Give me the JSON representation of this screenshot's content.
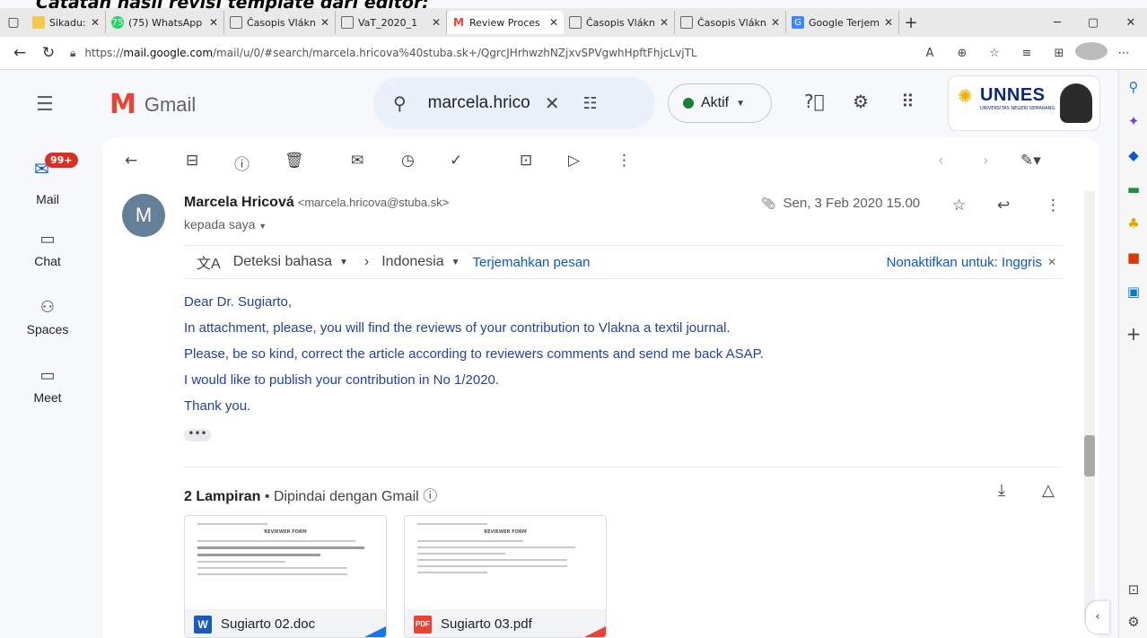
{
  "overlay_caption": "Catatan hasil revisi template dari editor:",
  "browser": {
    "tabs": [
      {
        "title": "Sikadu: UNNES",
        "icon": "folder-icon",
        "color": "#f2c94c",
        "active": false
      },
      {
        "title": "(75) WhatsApp",
        "icon": "whatsapp-icon",
        "color": "#25d366",
        "active": false
      },
      {
        "title": "Časopis Vlákna",
        "icon": "page-icon",
        "color": "#666666",
        "active": false
      },
      {
        "title": "VaT_2020_1",
        "icon": "page-icon",
        "color": "#666666",
        "active": false
      },
      {
        "title": "Review Proces",
        "icon": "gmail-icon",
        "color": "#ea4335",
        "active": true
      },
      {
        "title": "Časopis Vlákna",
        "icon": "page-icon",
        "color": "#666666",
        "active": false
      },
      {
        "title": "Časopis Vlákna",
        "icon": "page-icon",
        "color": "#666666",
        "active": false
      },
      {
        "title": "Google Terjemahan",
        "icon": "translate-icon",
        "color": "#4285f4",
        "active": false
      }
    ],
    "url": {
      "prefix": "https://",
      "host": "mail.google.com",
      "path": "/mail/u/0/#search/marcela.hricova%40stuba.sk+/QgrcJHrhwzhNZjxvSPVgwhHpftFhjcLvjTL"
    }
  },
  "gmail": {
    "app_name": "Gmail",
    "search_value": "marcela.hrico",
    "status_label": "Aktif",
    "brand_text": "UNNES",
    "brand_subtext": "UNIVERSITAS NEGERI SEMARANG",
    "rail": {
      "mail_badge": "99+",
      "items": [
        "Mail",
        "Chat",
        "Spaces",
        "Meet"
      ]
    },
    "message": {
      "sender_initial": "M",
      "sender_name": "Marcela Hricová",
      "sender_email": "<marcela.hricova@stuba.sk>",
      "to_label": "kepada saya",
      "date": "Sen, 3 Feb 2020 15.00",
      "translate": {
        "detect_label": "Deteksi bahasa",
        "target_label": "Indonesia",
        "translate_link": "Terjemahkan pesan",
        "disable_link": "Nonaktifkan untuk: Inggris"
      },
      "body_lines": [
        "Dear Dr. Sugiarto,",
        "In attachment, please, you will find the reviews of your contribution to Vlakna a textil journal.",
        "Please, be so kind, correct the article according to reviewers comments and send me back ASAP.",
        "I would like to publish your contribution in No 1/2020.",
        "Thank you."
      ],
      "ellipsis": "•••",
      "attachments_title": "2 Lampiran",
      "attachments_scan": "Dipindai dengan Gmail",
      "attachments": [
        {
          "name": "Sugiarto 02.doc",
          "type_label": "W",
          "color": "#185abd",
          "corner_color": "#1a73e8",
          "preview_title": "REVIEWER FORM"
        },
        {
          "name": "Sugiarto 03.pdf",
          "type_label": "PDF",
          "color": "#ea4335",
          "corner_color": "#ea4335",
          "preview_title": "REVIEWER FORM"
        }
      ]
    }
  },
  "colors": {
    "gmail_red": "#ea4335",
    "link_blue": "#0b57d0",
    "body_text": "#2540a0",
    "active_green": "#188038"
  }
}
